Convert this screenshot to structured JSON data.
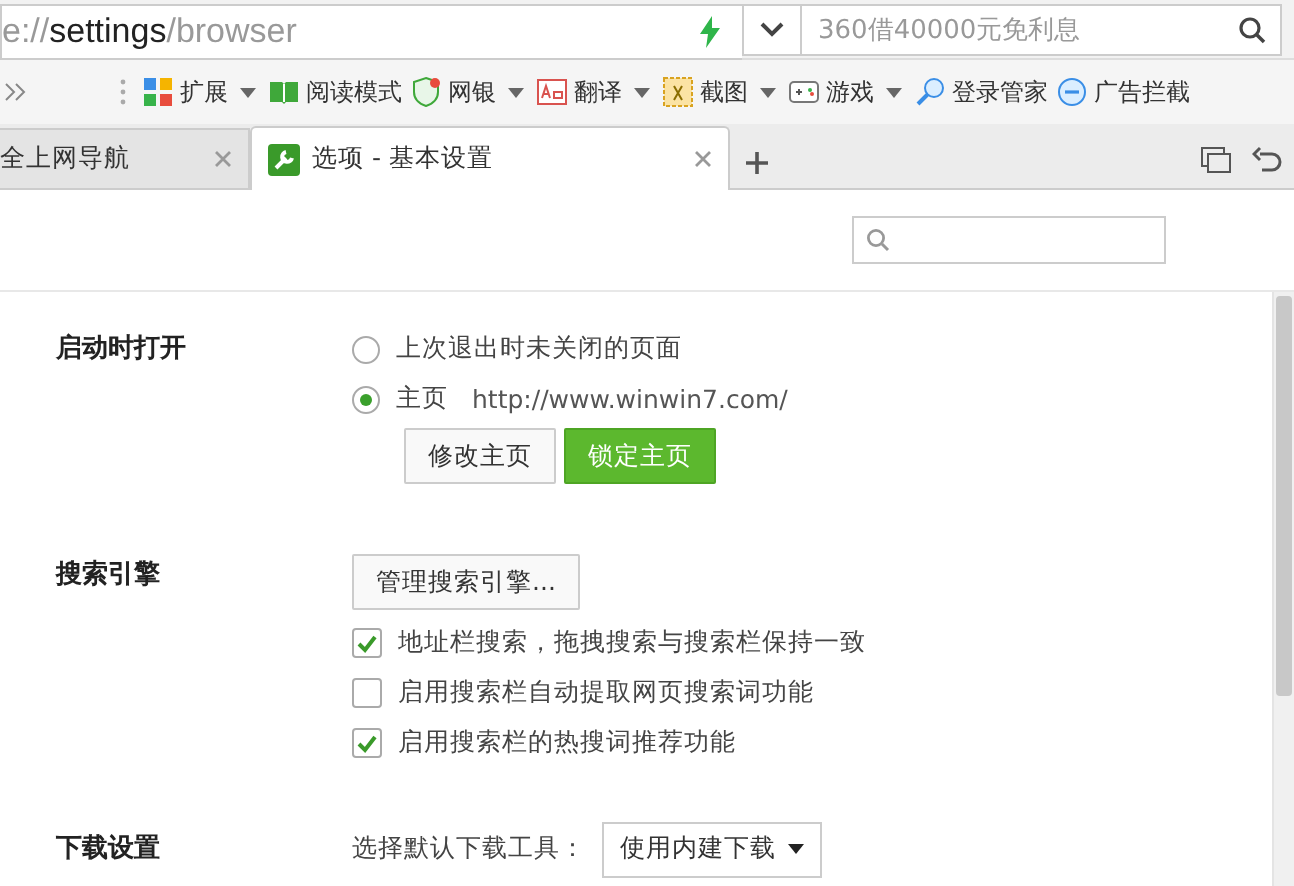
{
  "address_bar": {
    "url": {
      "scheme": "e://",
      "host": "settings",
      "path": "/browser"
    },
    "search_placeholder": "360借40000元免利息"
  },
  "toolbar": {
    "items": [
      {
        "label": "扩展",
        "has_menu": true
      },
      {
        "label": "阅读模式",
        "has_menu": false
      },
      {
        "label": "网银",
        "has_menu": true
      },
      {
        "label": "翻译",
        "has_menu": true
      },
      {
        "label": "截图",
        "has_menu": true
      },
      {
        "label": "游戏",
        "has_menu": true
      },
      {
        "label": "登录管家",
        "has_menu": false
      },
      {
        "label": "广告拦截",
        "has_menu": false
      }
    ]
  },
  "tabs": [
    {
      "label": "全上网导航",
      "selected": false
    },
    {
      "label": "选项 - 基本设置",
      "selected": true
    }
  ],
  "sections": [
    {
      "title": "启动时打开",
      "rows": [
        {
          "kind": "radio",
          "label": "上次退出时未关闭的页面",
          "selected": false
        },
        {
          "kind": "radio",
          "label": "主页",
          "detail": "http://www.winwin7.com/",
          "selected": true
        },
        {
          "kind": "buttons",
          "buttons": [
            {
              "label": "修改主页",
              "primary": false
            },
            {
              "label": "锁定主页",
              "primary": true
            }
          ]
        }
      ]
    },
    {
      "title": "搜索引擎",
      "rows": [
        {
          "kind": "buttons",
          "buttons": [
            {
              "label": "管理搜索引擎...",
              "primary": false
            }
          ]
        },
        {
          "kind": "checkbox",
          "label": "地址栏搜索，拖拽搜索与搜索栏保持一致",
          "checked": true
        },
        {
          "kind": "checkbox",
          "label": "启用搜索栏自动提取网页搜索词功能",
          "checked": false
        },
        {
          "kind": "checkbox",
          "label": "启用搜索栏的热搜词推荐功能",
          "checked": true
        }
      ]
    },
    {
      "title": "下载设置",
      "rows": [
        {
          "kind": "select",
          "label": "选择默认下载工具：",
          "value": "使用内建下载"
        }
      ]
    }
  ]
}
